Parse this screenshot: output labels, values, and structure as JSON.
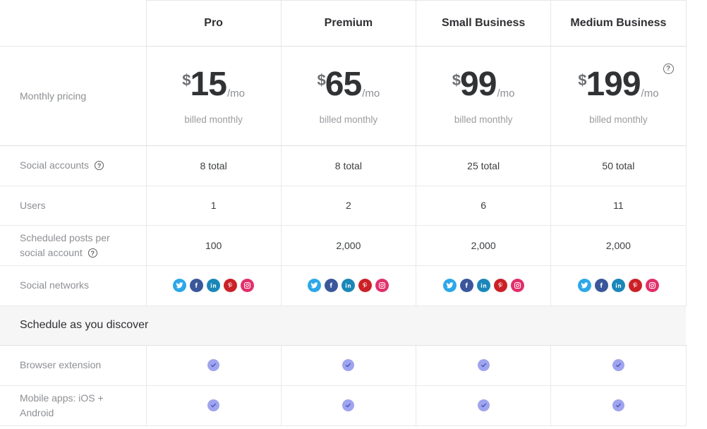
{
  "table": {
    "plans": [
      "Pro",
      "Premium",
      "Small Business",
      "Medium Business"
    ],
    "pricing_row": {
      "label": "Monthly pricing",
      "currency_symbol": "$",
      "period_suffix": "/mo",
      "billed_note": "billed monthly",
      "help_icon": "help-circle-icon",
      "prices": [
        "15",
        "65",
        "99",
        "199"
      ]
    },
    "rows": [
      {
        "label": "Social accounts",
        "help_icon": "help-circle-icon",
        "has_help": true,
        "values": [
          "8 total",
          "8 total",
          "25 total",
          "50 total"
        ]
      },
      {
        "label": "Users",
        "has_help": false,
        "values": [
          "1",
          "2",
          "6",
          "11"
        ]
      },
      {
        "label": "Scheduled posts per social account",
        "help_icon": "help-circle-icon",
        "has_help": true,
        "values": [
          "100",
          "2,000",
          "2,000",
          "2,000"
        ]
      }
    ],
    "social_networks_row": {
      "label": "Social networks",
      "icons": [
        "twitter-icon",
        "facebook-icon",
        "linkedin-icon",
        "pinterest-icon",
        "instagram-icon"
      ]
    },
    "section": {
      "title": "Schedule as you discover",
      "feature_rows": [
        {
          "label": "Browser extension",
          "check_icon": "check-circle-icon",
          "checks": [
            true,
            true,
            true,
            true
          ]
        },
        {
          "label": "Mobile apps: iOS + Android",
          "check_icon": "check-circle-icon",
          "checks": [
            true,
            true,
            true,
            true
          ]
        }
      ]
    }
  },
  "colors": {
    "border": "#e9e9e9",
    "section_background": "#f6f6f6",
    "label_text": "#8d8f93",
    "value_text": "#3b3d40",
    "heading_text": "#2f3033",
    "price_amount": "#303234",
    "price_currency": "#6e7074",
    "check_badge": "#9fa4ee",
    "check_mark": "#3f51b5",
    "twitter": "#2da7e8",
    "facebook": "#39579a",
    "linkedin": "#1a87b9",
    "pinterest": "#cb2027",
    "instagram": "#e1306c"
  }
}
